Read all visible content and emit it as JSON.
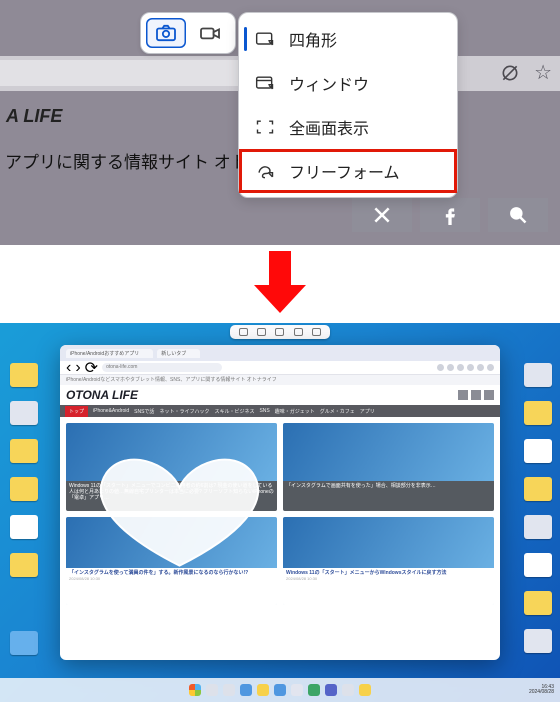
{
  "top": {
    "snip_toolbar": {
      "camera_tooltip": "画像の切り取り",
      "video_tooltip": "ビデオの切り取り"
    },
    "snip_menu": {
      "rect": "四角形",
      "window": "ウィンドウ",
      "fullscreen": "全画面表示",
      "freeform": "フリーフォーム"
    },
    "page": {
      "life_fragment": "A LIFE",
      "jp_line": "アプリに関する情報サイト オトナラ"
    },
    "social": {
      "x": "X",
      "fb": "f",
      "search": "🔍"
    }
  },
  "bottom": {
    "tabs": {
      "tab1": "iPhone/Androidおすすめアプリ",
      "tab2": "新しいタブ"
    },
    "url": "otona-life.com",
    "subtitle": "iPhone/Androidなどスマホやタブレット情報、SNS、アプリに関する情報サイト オトナライフ",
    "site_logo": "OTONA LIFE",
    "nav": [
      "トップ",
      "iPhone&Android",
      "SNSで話",
      "ネット・ライフハック",
      "スキル・ビジネス",
      "SNS",
      "趣味・ガジェット",
      "グルメ・カフェ",
      "アプリ"
    ],
    "cards": {
      "c1_cap": "Windows 11の「スタート」メニューでコンビニ利用者の約6割は? 現金の使い道をしている人は何と月あたりの値…無線自宅プリンターは本当に必要? フリーソフト知らないiPhoneの「電卓」アプリ…",
      "c2_cap": "「インスタグラムで画面共有を使った」場合、相談部分を非表示…",
      "c3_title": "「インスタグラムを使って満員の件を」する。新作風景になるのなら行かない!?",
      "c3_date": "2024/08/28 10:30",
      "c4_title": "Windows 11の「スタート」メニューからWindowsスタイルに戻す方法",
      "c4_date": "2024/08/28 10:30"
    },
    "taskbar": {
      "time": "16:43",
      "date": "2024/08/28"
    }
  }
}
